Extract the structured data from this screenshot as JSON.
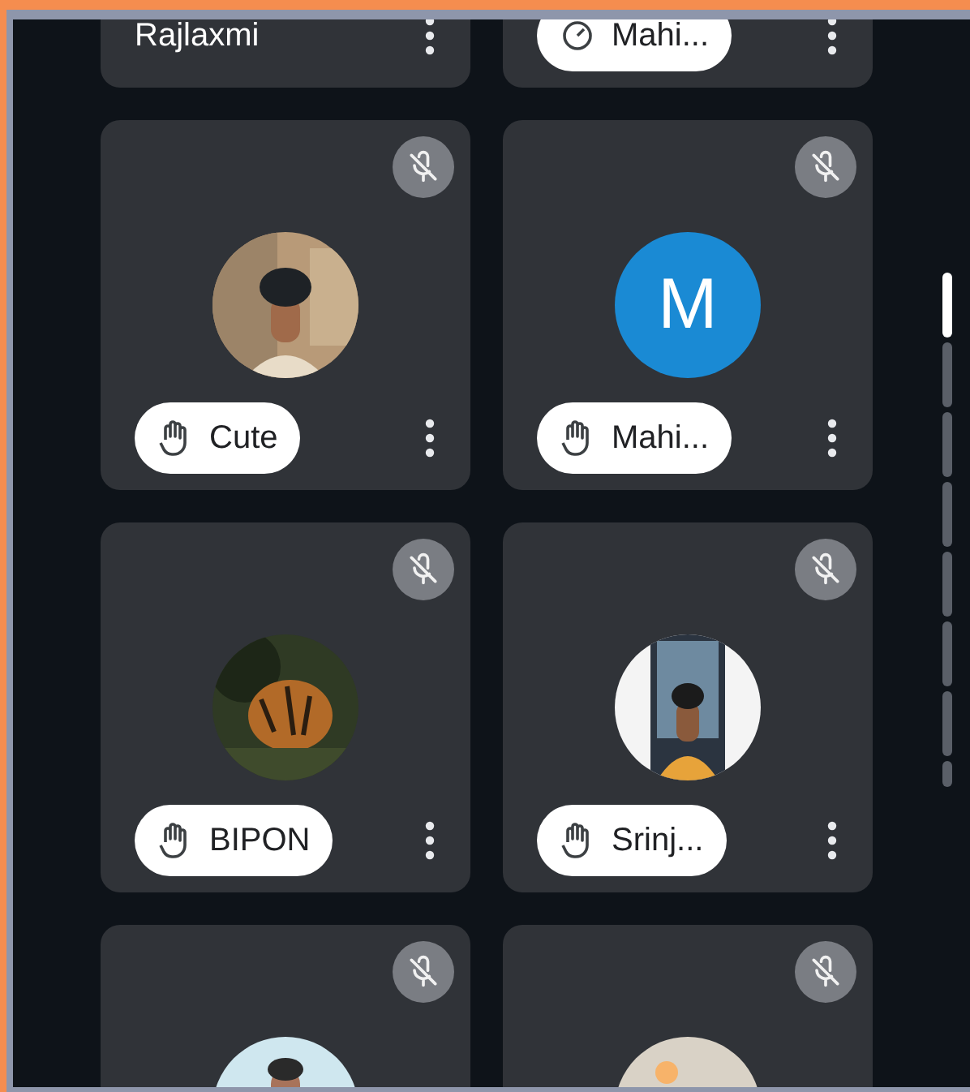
{
  "participants": [
    {
      "name": "Rajlaxmi",
      "kind": "plain"
    },
    {
      "name": "Mahi...",
      "kind": "dial"
    },
    {
      "name": "Cute",
      "kind": "hand",
      "muted": true
    },
    {
      "name": "Mahi...",
      "kind": "hand",
      "muted": true,
      "avatar": {
        "kind": "letter",
        "letter": "M",
        "color": "#1a8ad4"
      }
    },
    {
      "name": "BIPON",
      "kind": "hand",
      "muted": true
    },
    {
      "name": "Srinj...",
      "kind": "hand",
      "muted": true
    },
    {
      "muted": true
    },
    {
      "muted": true
    }
  ]
}
